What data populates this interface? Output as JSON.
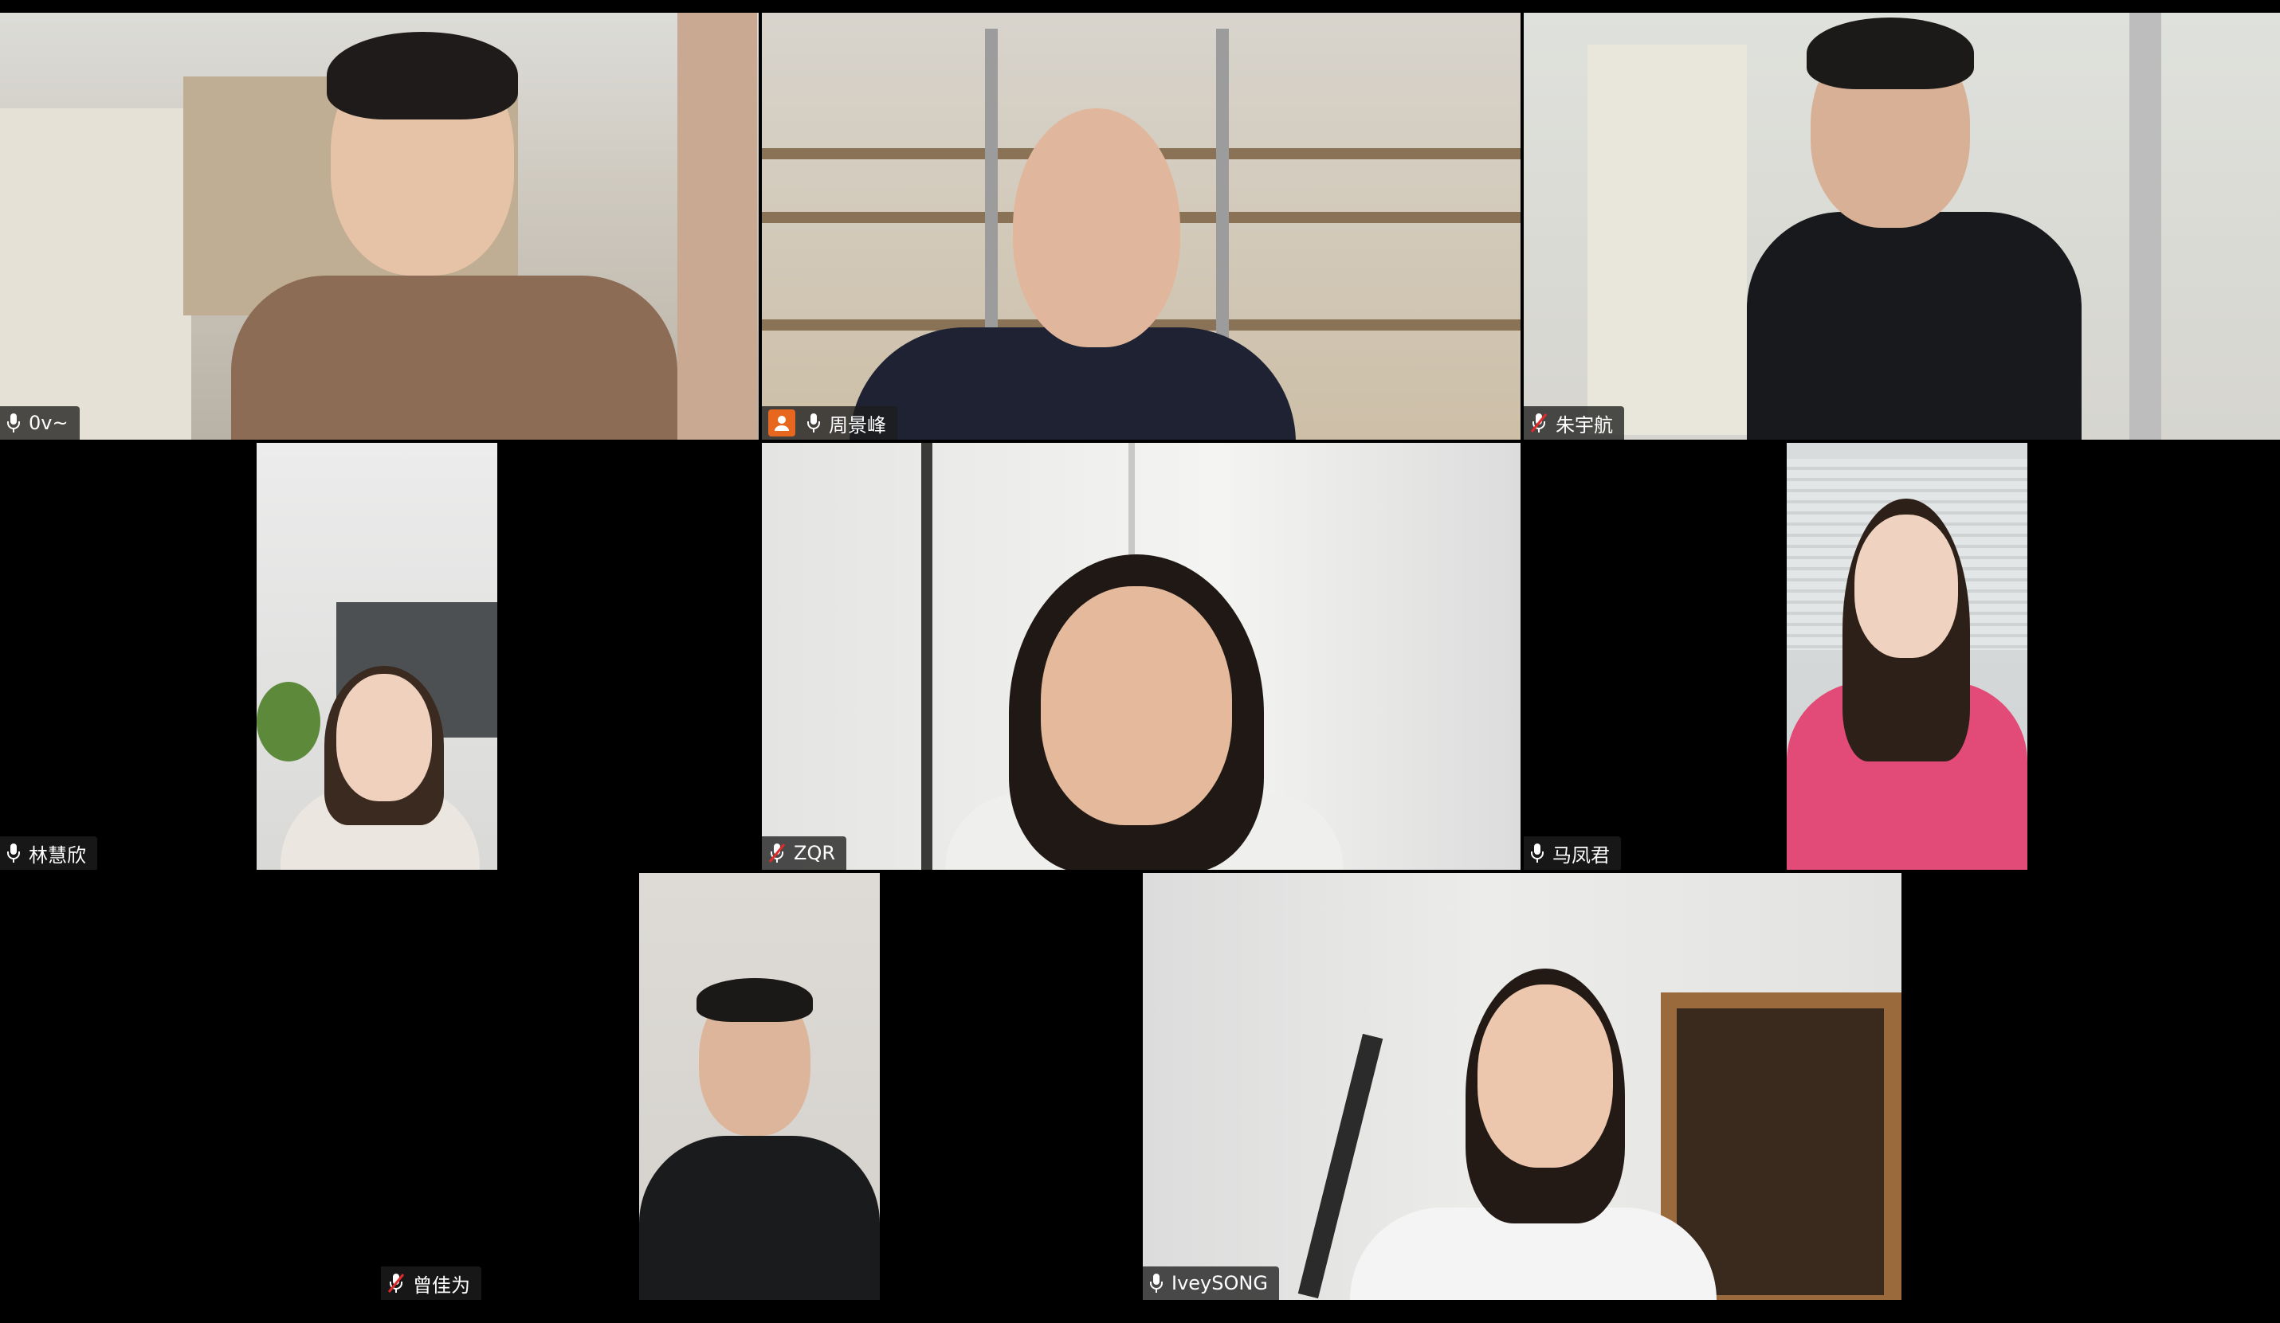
{
  "meeting": {
    "participants": [
      {
        "id": "p1",
        "name": "0v~",
        "mic": "on",
        "host": false,
        "active": true
      },
      {
        "id": "p2",
        "name": "周景峰",
        "mic": "on",
        "host": true,
        "active": false
      },
      {
        "id": "p3",
        "name": "朱宇航",
        "mic": "muted",
        "host": false,
        "active": false
      },
      {
        "id": "p4",
        "name": "林慧欣",
        "mic": "on",
        "host": false,
        "active": false
      },
      {
        "id": "p5",
        "name": "ZQR",
        "mic": "muted",
        "host": false,
        "active": false
      },
      {
        "id": "p6",
        "name": "马凤君",
        "mic": "on",
        "host": false,
        "active": false
      },
      {
        "id": "p7",
        "name": "曾佳为",
        "mic": "muted",
        "host": false,
        "active": false
      },
      {
        "id": "p8",
        "name": "IveySONG",
        "mic": "on",
        "host": false,
        "active": false
      }
    ]
  },
  "icons": {
    "mic": "microphone-icon",
    "mic_muted": "microphone-muted-icon",
    "host": "host-user-icon"
  },
  "colors": {
    "active_speaker_border": "#2dbf56",
    "host_badge": "#e8671f",
    "label_bg": "#1e1e1e"
  }
}
